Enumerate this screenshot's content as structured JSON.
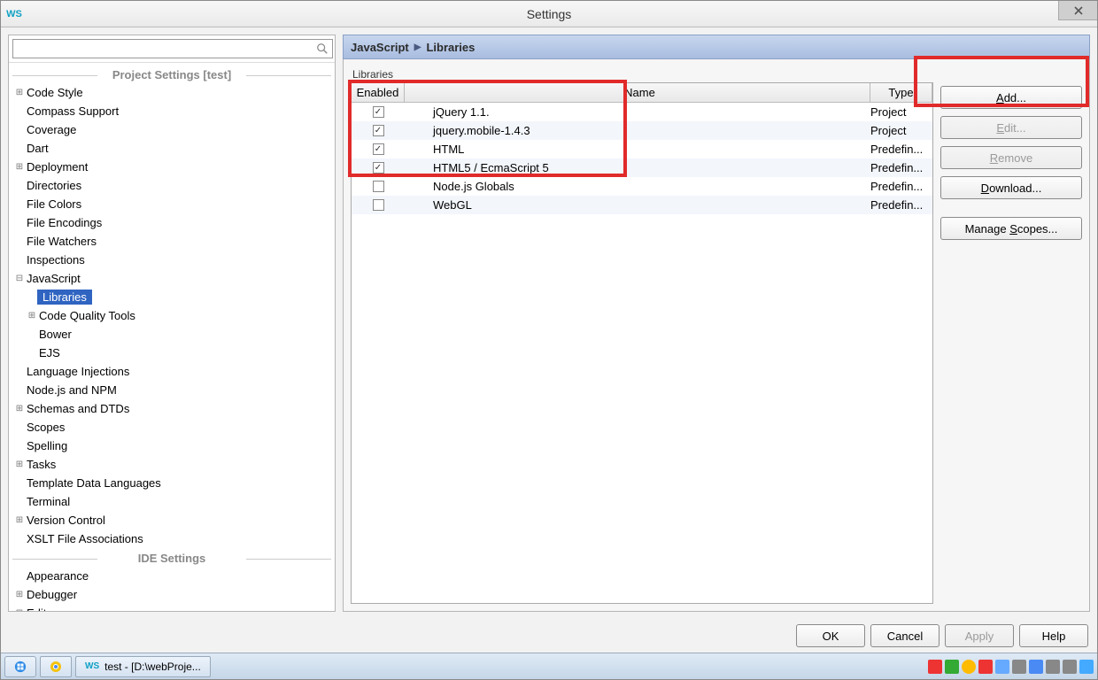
{
  "window": {
    "title": "Settings"
  },
  "sidebar": {
    "section1_title": "Project Settings [test]",
    "section2_title": "IDE Settings",
    "items": [
      {
        "label": "Code Style",
        "depth": 0,
        "exp": "+"
      },
      {
        "label": "Compass Support",
        "depth": 0,
        "exp": ""
      },
      {
        "label": "Coverage",
        "depth": 0,
        "exp": ""
      },
      {
        "label": "Dart",
        "depth": 0,
        "exp": ""
      },
      {
        "label": "Deployment",
        "depth": 0,
        "exp": "+"
      },
      {
        "label": "Directories",
        "depth": 0,
        "exp": ""
      },
      {
        "label": "File Colors",
        "depth": 0,
        "exp": ""
      },
      {
        "label": "File Encodings",
        "depth": 0,
        "exp": ""
      },
      {
        "label": "File Watchers",
        "depth": 0,
        "exp": ""
      },
      {
        "label": "Inspections",
        "depth": 0,
        "exp": ""
      },
      {
        "label": "JavaScript",
        "depth": 0,
        "exp": "−"
      },
      {
        "label": "Libraries",
        "depth": 1,
        "exp": "",
        "selected": true
      },
      {
        "label": "Code Quality Tools",
        "depth": 1,
        "exp": "+"
      },
      {
        "label": "Bower",
        "depth": 1,
        "exp": ""
      },
      {
        "label": "EJS",
        "depth": 1,
        "exp": ""
      },
      {
        "label": "Language Injections",
        "depth": 0,
        "exp": ""
      },
      {
        "label": "Node.js and NPM",
        "depth": 0,
        "exp": ""
      },
      {
        "label": "Schemas and DTDs",
        "depth": 0,
        "exp": "+"
      },
      {
        "label": "Scopes",
        "depth": 0,
        "exp": ""
      },
      {
        "label": "Spelling",
        "depth": 0,
        "exp": ""
      },
      {
        "label": "Tasks",
        "depth": 0,
        "exp": "+"
      },
      {
        "label": "Template Data Languages",
        "depth": 0,
        "exp": ""
      },
      {
        "label": "Terminal",
        "depth": 0,
        "exp": ""
      },
      {
        "label": "Version Control",
        "depth": 0,
        "exp": "+"
      },
      {
        "label": "XSLT File Associations",
        "depth": 0,
        "exp": ""
      }
    ],
    "items2": [
      {
        "label": "Appearance",
        "depth": 0,
        "exp": ""
      },
      {
        "label": "Debugger",
        "depth": 0,
        "exp": "+"
      },
      {
        "label": "Editor",
        "depth": 0,
        "exp": "+"
      }
    ]
  },
  "breadcrumb": {
    "a": "JavaScript",
    "b": "Libraries"
  },
  "libraries": {
    "panel_label": "Libraries",
    "headers": {
      "enabled": "Enabled",
      "name": "Name",
      "type": "Type"
    },
    "rows": [
      {
        "enabled": true,
        "name": "jQuery 1.1.",
        "type": "Project"
      },
      {
        "enabled": true,
        "name": "jquery.mobile-1.4.3",
        "type": "Project"
      },
      {
        "enabled": true,
        "name": "HTML",
        "type": "Predefin..."
      },
      {
        "enabled": true,
        "name": "HTML5 / EcmaScript 5",
        "type": "Predefin..."
      },
      {
        "enabled": false,
        "name": "Node.js Globals",
        "type": "Predefin..."
      },
      {
        "enabled": false,
        "name": "WebGL",
        "type": "Predefin..."
      }
    ]
  },
  "buttons": {
    "add": "Add...",
    "edit": "Edit...",
    "remove": "Remove",
    "download": "Download...",
    "manage": "Manage Scopes..."
  },
  "footer": {
    "ok": "OK",
    "cancel": "Cancel",
    "apply": "Apply",
    "help": "Help"
  },
  "taskbar": {
    "task": "test - [D:\\webProje...",
    "app_icon": "WS"
  }
}
